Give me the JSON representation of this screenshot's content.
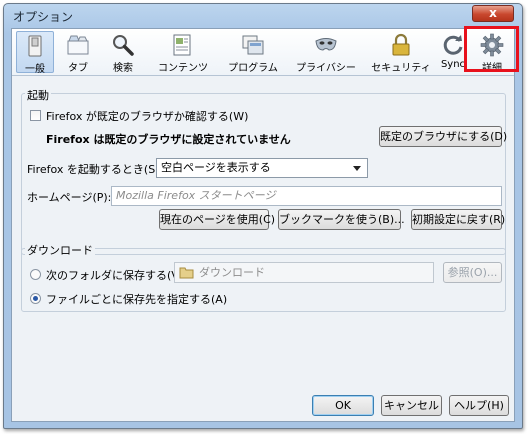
{
  "window": {
    "title": "オプション",
    "close_label": "x"
  },
  "toolbar": {
    "items": [
      {
        "label": "一般",
        "icon": "switch-icon",
        "selected": true
      },
      {
        "label": "タブ",
        "icon": "tabs-icon"
      },
      {
        "label": "検索",
        "icon": "magnifier-icon"
      },
      {
        "label": "コンテンツ",
        "icon": "content-page-icon"
      },
      {
        "label": "プログラム",
        "icon": "applications-icon"
      },
      {
        "label": "プライバシー",
        "icon": "privacy-mask-icon"
      },
      {
        "label": "セキュリティ",
        "icon": "padlock-icon"
      },
      {
        "label": "Sync",
        "icon": "sync-icon"
      },
      {
        "label": "詳細",
        "icon": "gear-icon",
        "highlighted": true
      }
    ]
  },
  "startup": {
    "group_label": "起動",
    "default_check_label": "Firefox が既定のブラウザか確認する(W)",
    "default_check_checked": false,
    "not_default_message": "Firefox は既定のブラウザに設定されていません",
    "make_default_button": "既定のブラウザにする(D)",
    "when_starts_label": "Firefox を起動するとき(S):",
    "when_starts_value": "空白ページを表示する",
    "homepage_label": "ホームページ(P):",
    "homepage_placeholder": "Mozilla Firefox スタートページ",
    "use_current_button": "現在のページを使用(C)",
    "use_bookmark_button": "ブックマークを使う(B)...",
    "restore_default_button": "初期設定に戻す(R)"
  },
  "downloads": {
    "group_label": "ダウンロード",
    "save_to_label": "次のフォルダに保存する(V)",
    "folder_value": "ダウンロード",
    "browse_button": "参照(O)...",
    "ask_each_label": "ファイルごとに保存先を指定する(A)",
    "selected_option": "ask_each"
  },
  "footer": {
    "ok_button": "OK",
    "cancel_button": "キャンセル",
    "help_button": "ヘルプ(H)"
  },
  "colors": {
    "highlight_box": "#e8111c",
    "title_bar": "#bcd5ee"
  }
}
